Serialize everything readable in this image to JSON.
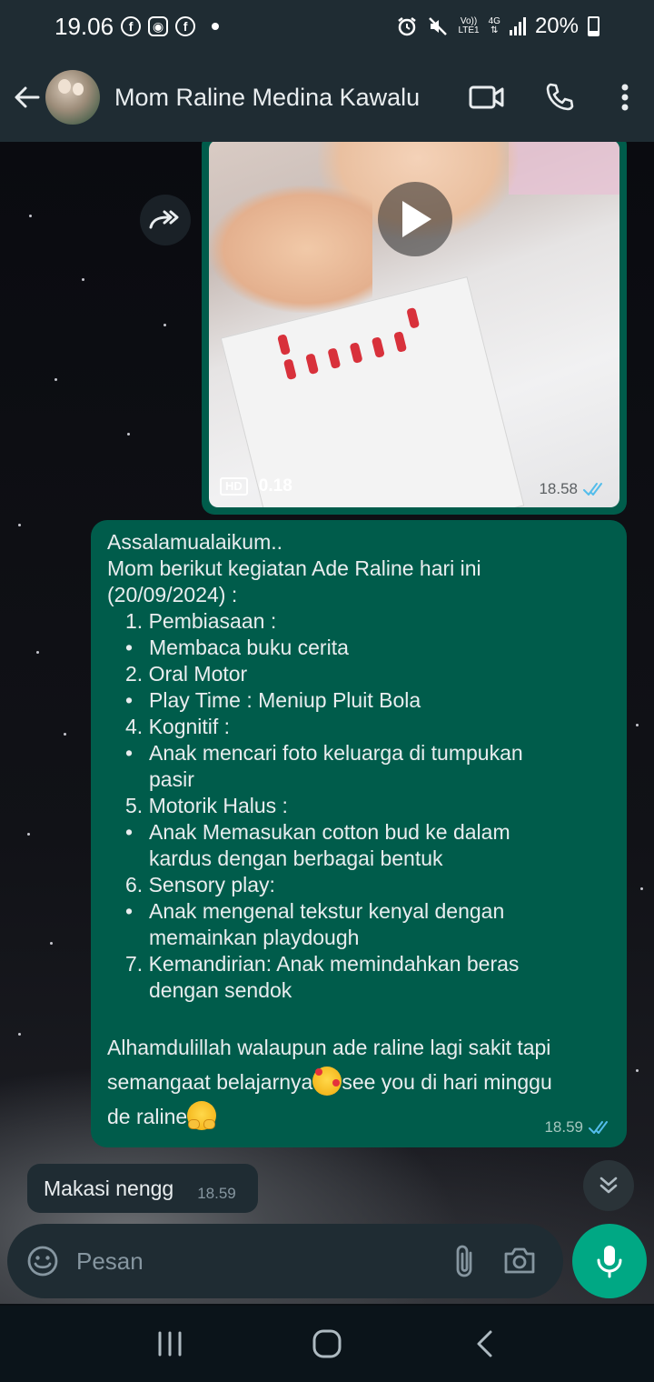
{
  "status_bar": {
    "time": "19.06",
    "battery": "20%",
    "net_top": "Vo))",
    "net_bottom": "LTE1",
    "data_type": "4G"
  },
  "header": {
    "contact_name": "Mom Raline Medina Kawalu"
  },
  "messages": {
    "video": {
      "hd_label": "HD",
      "duration": "0.18",
      "time": "18.58"
    },
    "text": {
      "lines": [
        "Assalamualaikum..",
        "Mom berikut kegiatan Ade Raline hari ini",
        "(20/09/2024) :",
        "1. Pembiasaan :",
        "Membaca buku cerita",
        "2. Oral Motor",
        "Play Time : Meniup Pluit Bola",
        "4. Kognitif :",
        "Anak mencari foto keluarga di tumpukan",
        "pasir",
        "5. Motorik Halus :",
        "Anak Memasukan cotton bud ke dalam",
        "kardus dengan berbagai bentuk",
        "6. Sensory play:",
        "Anak mengenal tekstur kenyal dengan",
        "memainkan playdough",
        "7. Kemandirian: Anak memindahkan beras",
        "dengan sendok"
      ],
      "bullet": "•",
      "closing_1": "Alhamdulillah walaupun ade raline lagi sakit tapi",
      "closing_2a": "semangaat belajarnya",
      "closing_2b": "see you di hari minggu",
      "closing_3": "de raline",
      "time": "18.59"
    },
    "incoming": {
      "text": "Makasi nengg",
      "time": "18.59"
    }
  },
  "composer": {
    "placeholder": "Pesan"
  },
  "colors": {
    "header_bg": "#1f2c33",
    "outgoing_bubble": "#005c4b",
    "incoming_bubble": "#1f2c33",
    "accent": "#00a884",
    "read_ticks": "#53bdeb"
  }
}
